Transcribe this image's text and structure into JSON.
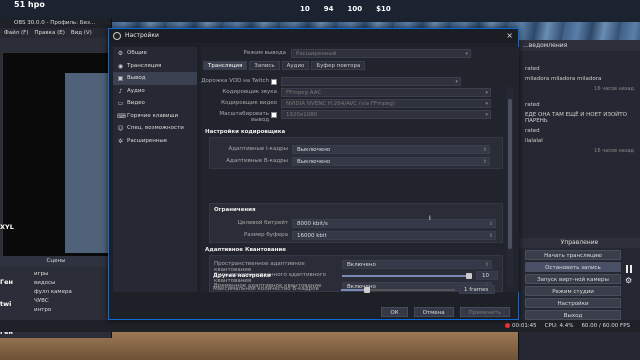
{
  "hud": {
    "items": [
      "51 hpo",
      "10",
      "94",
      "100",
      "$10"
    ]
  },
  "obs": {
    "window_title": "OBS 30.0.0 - Профиль: Без...",
    "menu": [
      "Файл (F)",
      "Правка (E)",
      "Вид (V)"
    ],
    "scenes_header": "Сцены",
    "scenes": [
      "игры",
      "видосы",
      "фулл камера",
      "ЧУВС",
      "интро"
    ]
  },
  "overlay": {
    "name1": "51 hpo",
    "xyl": "XYL",
    "ge1": "Ген",
    "tw": "twi",
    "ge2": "Ген"
  },
  "right_dock": {
    "header": "...ведомления",
    "chat": [
      {
        "text": "rated",
        "ts": ""
      },
      {
        "text": "miladora miladora miladora",
        "ts": "16 часов назад"
      },
      {
        "text": "rated",
        "ts": ""
      },
      {
        "text": "ЕДЕ ОНА ТАМ ЕЩЁ И НОЕТ ИЗОЙТО ПАРЕНЬ",
        "ts": ""
      },
      {
        "text": "rated",
        "ts": ""
      },
      {
        "text": "ilalalal",
        "ts": "16 часов назад"
      }
    ],
    "controls_header": "Управление",
    "buttons": [
      "Начать трансляцию",
      "Остановить запись",
      "Запуск вирт-ной камеры",
      "Режим студии",
      "Настройки",
      "Выход"
    ]
  },
  "status_bar": {
    "rec_time": "00:01:45",
    "cpu": "CPU: 4.4%",
    "fps": "60.00 / 60.00 FPS"
  },
  "dialog": {
    "title": "Настройки",
    "close": "×",
    "output_mode_label": "Режим вывода",
    "output_mode_value": "Расширенный",
    "tabs": [
      "Трансляция",
      "Запись",
      "Аудио",
      "Буфер повтора"
    ],
    "selected_tab": 0,
    "rows": [
      {
        "label": "Дорожка VOD на Twitch",
        "value": "",
        "type": "check"
      },
      {
        "label": "Кодировщик звука",
        "value": "FFmpeg AAC"
      },
      {
        "label": "Кодировщик видео",
        "value": "NVIDIA NVENC H.264/AVC (via FFmpeg)"
      },
      {
        "label": "Масштабировать вывод",
        "value": "1920x1080",
        "type": "check"
      }
    ],
    "encoder_settings_header": "Настройки кодировщика",
    "encoder_rows": [
      {
        "label": "Адаптивные I-кадры",
        "value": "Выключено"
      },
      {
        "label": "Адаптивные B-кадры",
        "value": "Выключено"
      }
    ],
    "limits_header": "Ограничения",
    "limits": [
      {
        "label": "Целевой битрейт",
        "value": "8000 kbit/s"
      },
      {
        "label": "Размер буфера",
        "value": "16000 kbit"
      }
    ],
    "aq_header": "Адаптивное Квантование",
    "aq_rows": [
      {
        "label": "Пространственное адаптивное квантование",
        "value": "Включено"
      },
      {
        "label": "Сила пространственного адаптивного квантования",
        "value": "10",
        "type": "slider",
        "level": 1.0
      },
      {
        "label": "Временное адаптивное квантование",
        "value": "Включено"
      }
    ],
    "other_header": "Другие настройки",
    "other_rows": [
      {
        "label": "Максимальное количество B-кадров",
        "value": "1 frames",
        "type": "slider",
        "level": 0.25
      }
    ],
    "sidebar": [
      {
        "label": "Общие",
        "icon": "gear-icon",
        "glyph": "⚙"
      },
      {
        "label": "Трансляция",
        "icon": "globe-icon",
        "glyph": "◉"
      },
      {
        "label": "Вывод",
        "icon": "output-icon",
        "glyph": "▣"
      },
      {
        "label": "Аудио",
        "icon": "speaker-icon",
        "glyph": "♪"
      },
      {
        "label": "Видео",
        "icon": "monitor-icon",
        "glyph": "▭"
      },
      {
        "label": "Горячие клавиши",
        "icon": "keyboard-icon",
        "glyph": "⌨"
      },
      {
        "label": "Спец. возможности",
        "icon": "accessibility-icon",
        "glyph": "☺"
      },
      {
        "label": "Расширенные",
        "icon": "wrench-icon",
        "glyph": "✲"
      }
    ],
    "selected_sidebar": 2,
    "buttons": {
      "ok": "ОК",
      "cancel": "Отмена",
      "apply": "Применить"
    }
  }
}
